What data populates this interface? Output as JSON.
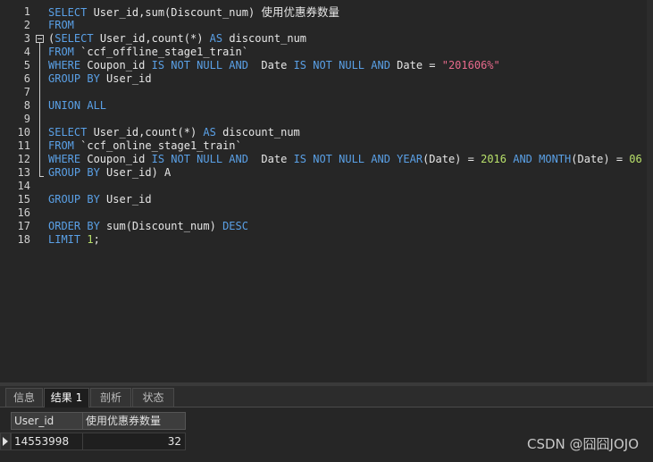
{
  "editor": {
    "line_numbers": [
      "1",
      "2",
      "3",
      "4",
      "5",
      "6",
      "7",
      "8",
      "9",
      "10",
      "11",
      "12",
      "13",
      "14",
      "15",
      "16",
      "17",
      "18"
    ],
    "lines": [
      [
        {
          "t": "SELECT",
          "c": "kw"
        },
        {
          "t": " User_id,sum(Discount_num) ",
          "c": ""
        },
        {
          "t": "使用优惠券数量",
          "c": "zh"
        }
      ],
      [
        {
          "t": "FROM",
          "c": "kw"
        }
      ],
      [
        {
          "t": "(",
          "c": ""
        },
        {
          "t": "SELECT",
          "c": "kw"
        },
        {
          "t": " User_id,count(*) ",
          "c": ""
        },
        {
          "t": "AS",
          "c": "kw"
        },
        {
          "t": " discount_num",
          "c": ""
        }
      ],
      [
        {
          "t": "FROM",
          "c": "kw"
        },
        {
          "t": " `ccf_offline_stage1_train`",
          "c": ""
        }
      ],
      [
        {
          "t": "WHERE",
          "c": "kw"
        },
        {
          "t": " Coupon_id ",
          "c": ""
        },
        {
          "t": "IS NOT NULL AND",
          "c": "kw"
        },
        {
          "t": "  Date ",
          "c": ""
        },
        {
          "t": "IS NOT NULL AND",
          "c": "kw"
        },
        {
          "t": " Date = ",
          "c": ""
        },
        {
          "t": "\"201606%\"",
          "c": "str"
        }
      ],
      [
        {
          "t": "GROUP BY",
          "c": "kw"
        },
        {
          "t": " User_id",
          "c": ""
        }
      ],
      [],
      [
        {
          "t": "UNION ALL",
          "c": "kw"
        }
      ],
      [],
      [
        {
          "t": "SELECT",
          "c": "kw"
        },
        {
          "t": " User_id,count(*) ",
          "c": ""
        },
        {
          "t": "AS",
          "c": "kw"
        },
        {
          "t": " discount_num",
          "c": ""
        }
      ],
      [
        {
          "t": "FROM",
          "c": "kw"
        },
        {
          "t": " `ccf_online_stage1_train`",
          "c": ""
        }
      ],
      [
        {
          "t": "WHERE",
          "c": "kw"
        },
        {
          "t": " Coupon_id ",
          "c": ""
        },
        {
          "t": "IS NOT NULL AND",
          "c": "kw"
        },
        {
          "t": "  Date ",
          "c": ""
        },
        {
          "t": "IS NOT NULL AND YEAR",
          "c": "kw"
        },
        {
          "t": "(Date) = ",
          "c": ""
        },
        {
          "t": "2016",
          "c": "num"
        },
        {
          "t": " ",
          "c": ""
        },
        {
          "t": "AND MONTH",
          "c": "kw"
        },
        {
          "t": "(Date) = ",
          "c": ""
        },
        {
          "t": "06",
          "c": "num"
        }
      ],
      [
        {
          "t": "GROUP BY",
          "c": "kw"
        },
        {
          "t": " User_id) A",
          "c": ""
        }
      ],
      [],
      [
        {
          "t": "GROUP BY",
          "c": "kw"
        },
        {
          "t": " User_id",
          "c": ""
        }
      ],
      [],
      [
        {
          "t": "ORDER BY",
          "c": "kw"
        },
        {
          "t": " sum(Discount_num) ",
          "c": ""
        },
        {
          "t": "DESC",
          "c": "kw"
        }
      ],
      [
        {
          "t": "LIMIT",
          "c": "kw"
        },
        {
          "t": " ",
          "c": ""
        },
        {
          "t": "1",
          "c": "num"
        },
        {
          "t": ";",
          "c": ""
        }
      ]
    ]
  },
  "tabs": [
    {
      "label": "信息",
      "active": false
    },
    {
      "label": "结果 1",
      "active": true
    },
    {
      "label": "剖析",
      "active": false
    },
    {
      "label": "状态",
      "active": false
    }
  ],
  "grid": {
    "headers": [
      "User_id",
      "使用优惠券数量"
    ],
    "rows": [
      [
        "14553998",
        "32"
      ]
    ]
  },
  "watermark": "CSDN @囧囧JOJO",
  "colors": {
    "keyword": "#5aa0e6",
    "string": "#e86a8c",
    "number": "#b8e06a",
    "background": "#262626"
  }
}
